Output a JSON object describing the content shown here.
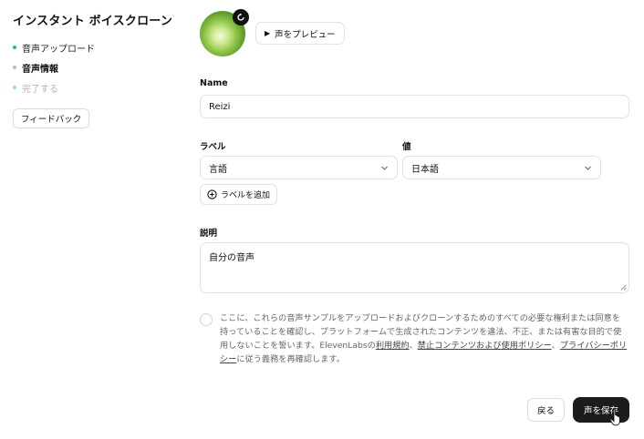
{
  "sidebar": {
    "title": "インスタント ボイスクローン",
    "steps": [
      {
        "label": "音声アップロード",
        "state": "done"
      },
      {
        "label": "音声情報",
        "state": "active"
      },
      {
        "label": "完了する",
        "state": "pending"
      }
    ],
    "feedback_label": "フィードバック"
  },
  "voice": {
    "preview_label": "声をプレビュー"
  },
  "form": {
    "name_label": "Name",
    "name_value": "Reizi",
    "label_header": "ラベル",
    "value_header": "値",
    "label_select_value": "言語",
    "value_select_value": "日本語",
    "add_label": "ラベルを追加",
    "description_label": "説明",
    "description_value": "自分の音声"
  },
  "consent": {
    "text_1": "ここに、これらの音声サンプルをアップロードおよびクローンするためのすべての必要な権利または同意を持っていることを確認し、プラットフォームで生成されたコンテンツを違法、不正、または有害な目的で使用しないことを誓います。ElevenLabsの",
    "link_terms": "利用規約",
    "sep_1": "、",
    "link_prohibited": "禁止コンテンツおよび使用ポリシー",
    "sep_2": "、",
    "link_privacy": "プライバシーポリシー",
    "text_2": "に従う義務を再確認します。"
  },
  "footer": {
    "back_label": "戻る",
    "save_label": "声を保存"
  },
  "colors": {
    "accent_dark": "#1c1c1c",
    "step_done": "#22c55e",
    "avatar_green": "#8fc548"
  },
  "icons": [
    "refresh-icon",
    "play-icon",
    "chevron-down-icon",
    "plus-circle-icon",
    "resize-handle-icon",
    "pointer-cursor-icon"
  ]
}
